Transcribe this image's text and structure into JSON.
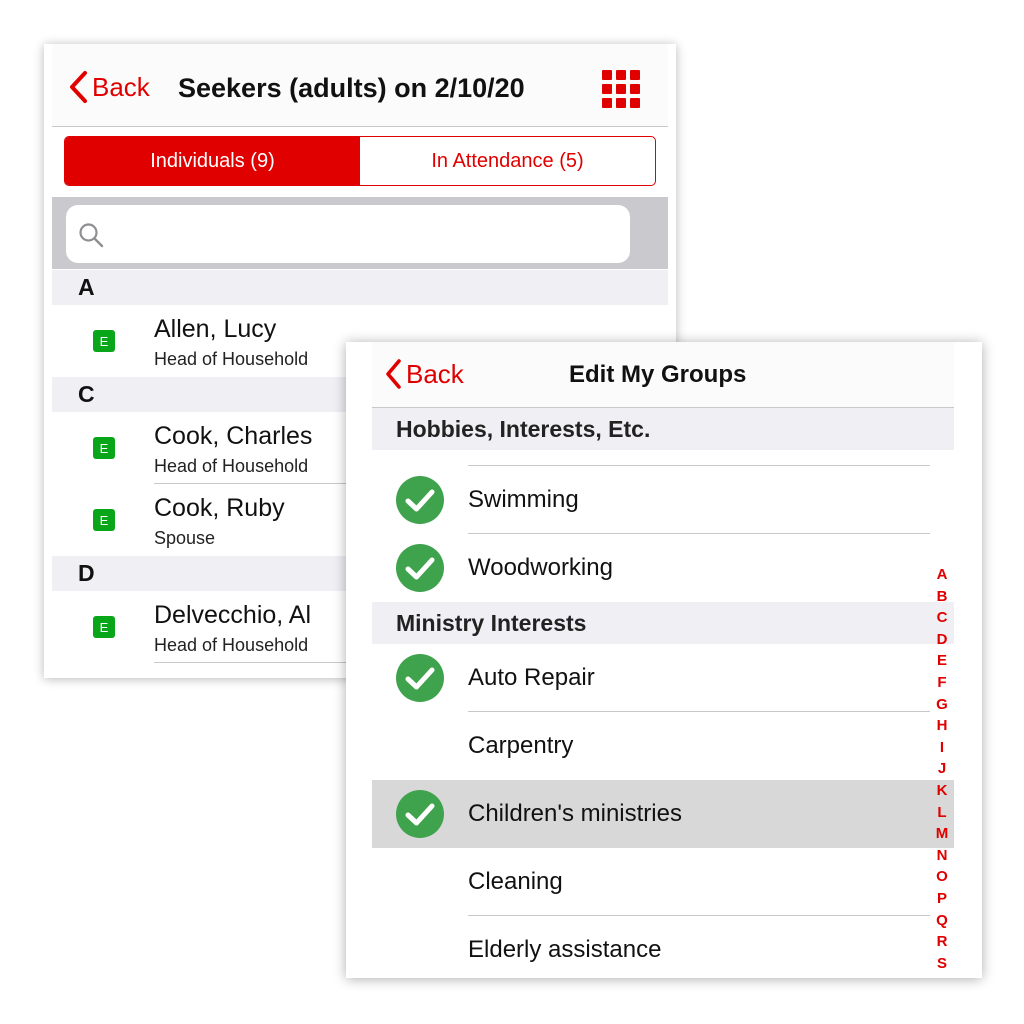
{
  "screen1": {
    "nav": {
      "back_label": "Back",
      "title": "Seekers (adults) on 2/10/20"
    },
    "segment": {
      "individuals": "Individuals (9)",
      "attendance": "In Attendance (5)"
    },
    "search": {
      "placeholder": ""
    },
    "sections": [
      {
        "letter": "A",
        "people": [
          {
            "badge": "E",
            "name": "Allen, Lucy",
            "role": "Head of Household"
          }
        ]
      },
      {
        "letter": "C",
        "people": [
          {
            "badge": "E",
            "name": "Cook, Charles",
            "role": "Head of Household"
          },
          {
            "badge": "E",
            "name": "Cook, Ruby",
            "role": "Spouse"
          }
        ]
      },
      {
        "letter": "D",
        "people": [
          {
            "badge": "E",
            "name": "Delvecchio, Al",
            "role": "Head of Household"
          }
        ]
      }
    ]
  },
  "screen2": {
    "nav": {
      "back_label": "Back",
      "title": "Edit My Groups"
    },
    "sections": [
      {
        "title": "Hobbies, Interests, Etc.",
        "items": [
          {
            "label": "Swimming",
            "checked": true
          },
          {
            "label": "Woodworking",
            "checked": true
          }
        ]
      },
      {
        "title": "Ministry Interests",
        "items": [
          {
            "label": "Auto Repair",
            "checked": true
          },
          {
            "label": "Carpentry",
            "checked": false
          },
          {
            "label": "Children's ministries",
            "checked": true,
            "highlighted": true
          },
          {
            "label": "Cleaning",
            "checked": false
          },
          {
            "label": "Elderly assistance",
            "checked": false
          }
        ]
      }
    ],
    "index_letters": [
      "A",
      "B",
      "C",
      "D",
      "E",
      "F",
      "G",
      "H",
      "I",
      "J",
      "K",
      "L",
      "M",
      "N",
      "O",
      "P",
      "Q",
      "R",
      "S"
    ]
  },
  "colors": {
    "accent": "#e00000",
    "badge": "#0aa61a",
    "check": "#3fa34d",
    "header_bg": "#efeff4"
  }
}
